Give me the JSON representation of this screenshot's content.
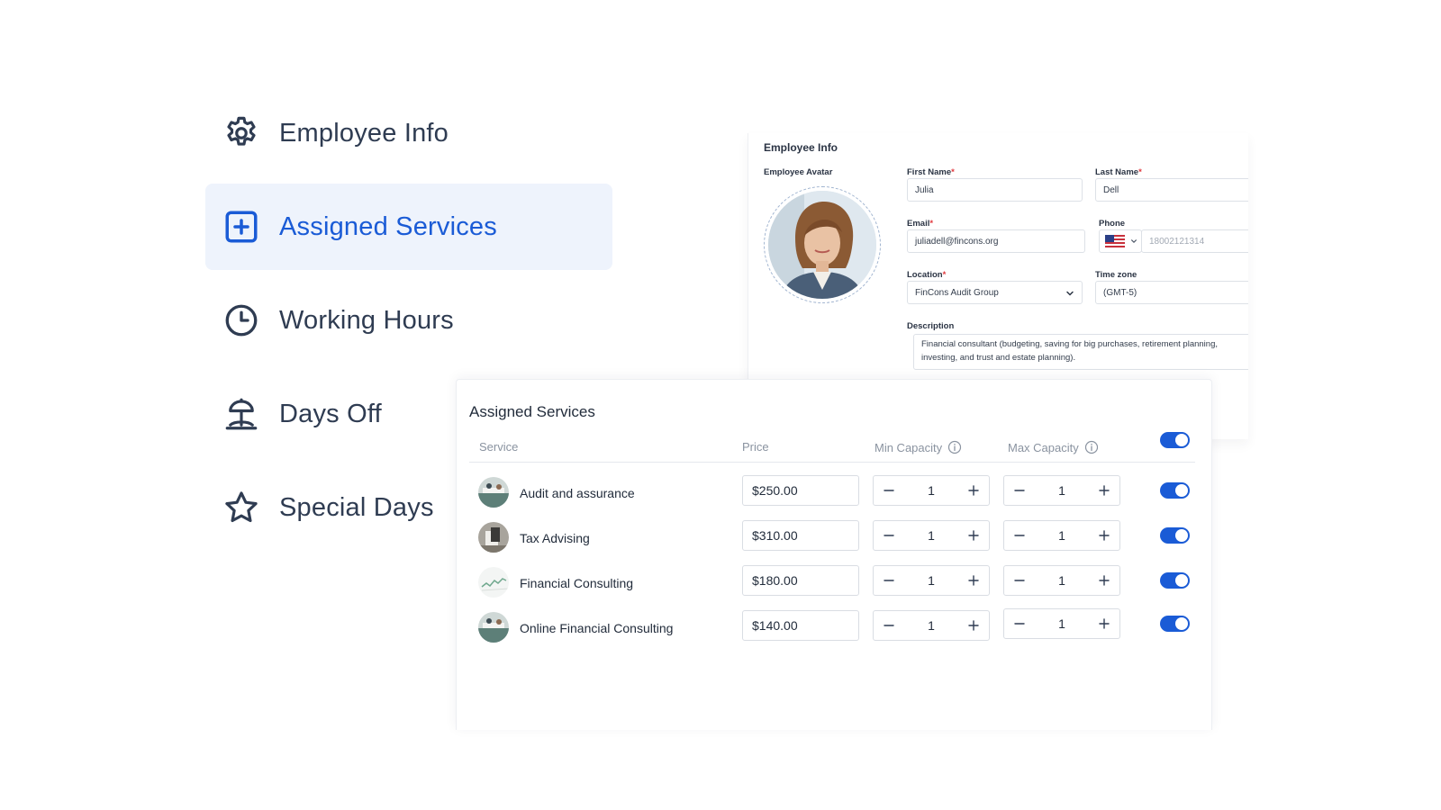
{
  "nav": {
    "items": [
      {
        "label": "Employee Info",
        "icon": "gear-icon"
      },
      {
        "label": "Assigned Services",
        "icon": "plus-square-icon",
        "active": true
      },
      {
        "label": "Working Hours",
        "icon": "clock-icon"
      },
      {
        "label": "Days Off",
        "icon": "beach-umbrella-icon"
      },
      {
        "label": "Special Days",
        "icon": "star-icon"
      }
    ]
  },
  "employee": {
    "title": "Employee Info",
    "avatar_label": "Employee Avatar",
    "first_name_label": "First Name",
    "first_name": "Julia",
    "last_name_label": "Last Name",
    "last_name": "Dell",
    "email_label": "Email",
    "email": "juliadell@fincons.org",
    "phone_label": "Phone",
    "phone_placeholder": "18002121314",
    "location_label": "Location",
    "location": "FinCons Audit Group",
    "timezone_label": "Time zone",
    "timezone": "(GMT-5)",
    "description_label": "Description",
    "description_line1": "Financial consultant (budgeting, saving for big purchases, retirement planning,",
    "description_line2": "investing, and trust and estate planning).",
    "required_mark": "*"
  },
  "services": {
    "title": "Assigned Services",
    "headers": {
      "service": "Service",
      "price": "Price",
      "min_capacity": "Min Capacity",
      "max_capacity": "Max Capacity"
    },
    "rows": [
      {
        "name": "Audit and assurance",
        "price": "$250.00",
        "min": "1",
        "max": "1",
        "enabled": true
      },
      {
        "name": "Tax Advising",
        "price": "$310.00",
        "min": "1",
        "max": "1",
        "enabled": true
      },
      {
        "name": "Financial Consulting",
        "price": "$180.00",
        "min": "1",
        "max": "1",
        "enabled": true
      },
      {
        "name": "Online Financial Consulting",
        "price": "$140.00",
        "min": "1",
        "max": "1",
        "enabled": true
      }
    ]
  },
  "colors": {
    "accent": "#1a5bd6",
    "active_bg": "#eef3fc",
    "text": "#2f3c52",
    "required": "#e0393e"
  }
}
